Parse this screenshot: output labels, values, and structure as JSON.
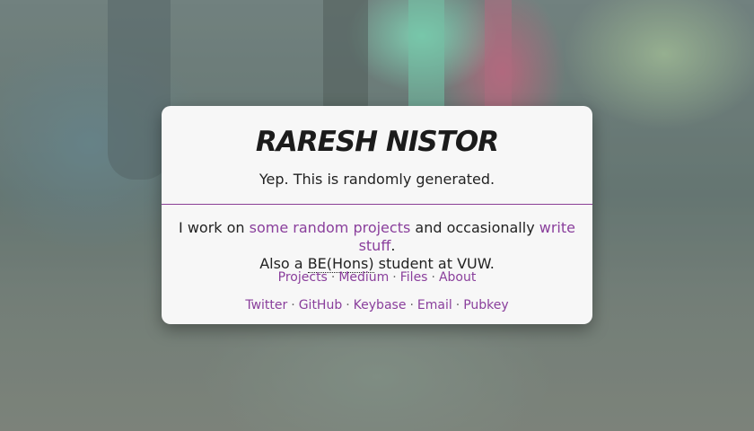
{
  "header": {
    "name": "RARESH NISTOR",
    "tagline": "Yep. This is randomly generated."
  },
  "bio": {
    "prefix": "I work on",
    "projects_link": "some random projects",
    "middle": "and occasionally",
    "write_link": "write stuff",
    "period": ".",
    "line2_prefix": "Also a",
    "degree": "BE(Hons)",
    "line2_suffix": "student at VUW."
  },
  "nav_primary": [
    {
      "label": "Projects"
    },
    {
      "label": "Medium"
    },
    {
      "label": "Files"
    },
    {
      "label": "About"
    }
  ],
  "nav_social": [
    {
      "label": "Twitter"
    },
    {
      "label": "GitHub"
    },
    {
      "label": "Keybase"
    },
    {
      "label": "Email"
    },
    {
      "label": "Pubkey"
    }
  ],
  "separator": "·",
  "colors": {
    "accent": "#8a3f9c",
    "card_bg": "#f7f7f7",
    "text": "#222222"
  }
}
